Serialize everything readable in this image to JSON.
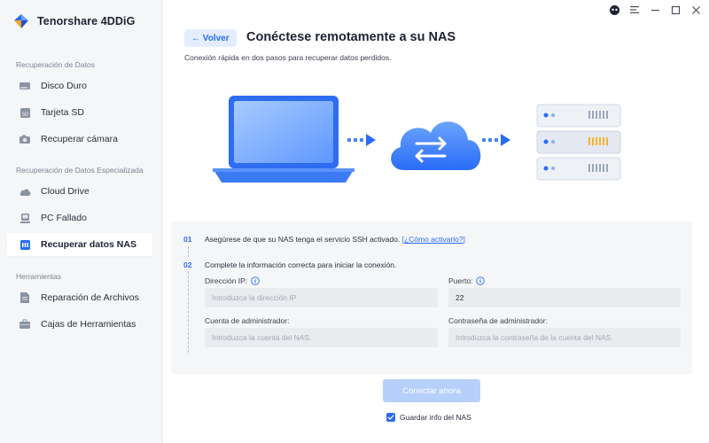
{
  "app": {
    "name": "Tenorshare 4DDiG"
  },
  "sidebar": {
    "sections": [
      {
        "label": "Recuperación de Datos"
      },
      {
        "label": "Recuperación de Datos Especializada"
      },
      {
        "label": "Herramientas"
      }
    ],
    "items": [
      {
        "label": "Disco Duro",
        "icon": "hard-drive-icon"
      },
      {
        "label": "Tarjeta SD",
        "icon": "sd-card-icon"
      },
      {
        "label": "Recuperar cámara",
        "icon": "camera-icon"
      },
      {
        "label": "Cloud Drive",
        "icon": "cloud-icon"
      },
      {
        "label": "PC Fallado",
        "icon": "crashed-pc-icon"
      },
      {
        "label": "Recuperar datos NAS",
        "icon": "nas-icon",
        "active": true
      },
      {
        "label": "Reparación de Archivos",
        "icon": "file-repair-icon"
      },
      {
        "label": "Cajas de Herramientas",
        "icon": "toolbox-icon"
      }
    ]
  },
  "header": {
    "back_label": "← Volver",
    "title": "Conéctese remotamente a su NAS",
    "subtitle": "Conexión rápida en dos pasos para recuperar datos perdidos."
  },
  "steps": {
    "step1": {
      "number": "01",
      "text": "Asegúrese de que su NAS tenga el servicio SSH activado.",
      "link": "¿Cómo activarlo?"
    },
    "step2": {
      "number": "02",
      "text": "Complete la información correcta para iniciar la conexión."
    }
  },
  "form": {
    "ip_label": "Dirección IP:",
    "ip_placeholder": "Introduzca la dirección IP",
    "ip_value": "",
    "port_label": "Puerto:",
    "port_value": "22",
    "admin_label": "Cuenta de administrador:",
    "admin_placeholder": "Introduzca la cuenta del NAS.",
    "password_label": "Contraseña de administrador:",
    "password_placeholder": "Introduzca la contraseña de la cuenta del NAS."
  },
  "actions": {
    "connect_label": "Conectar ahora",
    "save_label": "Guardar info del NAS",
    "save_checked": true
  },
  "colors": {
    "accent": "#2b6cf6",
    "sidebar_bg": "#f5f6f8",
    "panel_bg": "#f5f6f8",
    "button_disabled": "#b7cffb"
  }
}
